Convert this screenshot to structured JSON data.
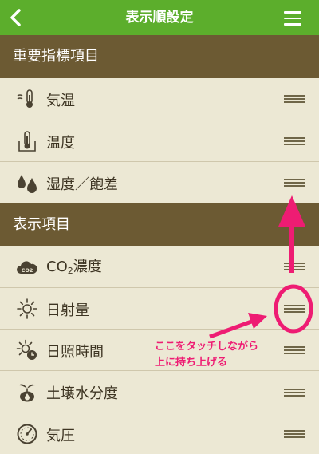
{
  "navbar": {
    "title": "表示順設定"
  },
  "sections": [
    {
      "header": "重要指標項目",
      "items": [
        {
          "label": "気温",
          "icon": "thermometer-wind-icon"
        },
        {
          "label": "温度",
          "icon": "soil-thermometer-icon"
        },
        {
          "label": "湿度／飽差",
          "icon": "water-drops-icon"
        }
      ]
    },
    {
      "header": "表示項目",
      "items": [
        {
          "label": "CO",
          "label_sub": "2",
          "label_suffix": "濃度",
          "icon": "co2-cloud-icon"
        },
        {
          "label": "日射量",
          "icon": "sun-icon"
        },
        {
          "label": "日照時間",
          "icon": "sun-clock-icon"
        },
        {
          "label": "土壌水分度",
          "icon": "soil-moisture-icon"
        },
        {
          "label": "気圧",
          "icon": "pressure-gauge-icon"
        }
      ]
    }
  ],
  "annotation": {
    "line1": "ここをタッチしながら",
    "line2": "上に持ち上げる"
  },
  "colors": {
    "navbar": "#5cae2c",
    "section_header": "#6c5a33",
    "background": "#ece8d4",
    "annotation": "#ee1c73"
  }
}
